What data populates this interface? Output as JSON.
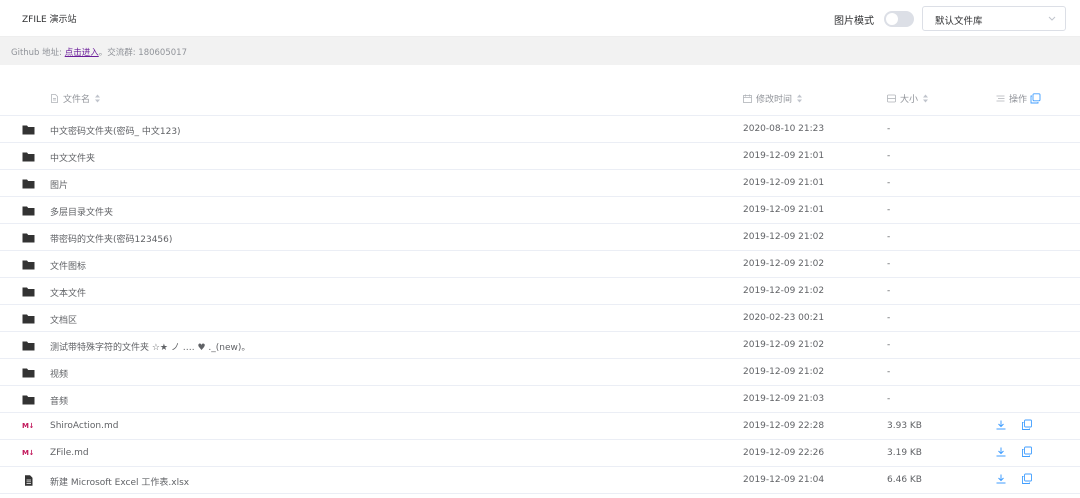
{
  "header": {
    "site_title": "ZFILE 演示站",
    "image_mode_label": "图片模式",
    "image_mode_on": false,
    "drive_select": "默认文件库"
  },
  "infobar": {
    "prefix": "Github 地址: ",
    "link_text": "点击进入",
    "suffix": "。交流群: 180605017"
  },
  "table": {
    "columns": {
      "name": "文件名",
      "time": "修改时间",
      "size": "大小",
      "ops": "操作"
    },
    "rows": [
      {
        "type": "folder",
        "name": "中文密码文件夹(密码_ 中文123)",
        "time": "2020-08-10 21:23",
        "size": "-"
      },
      {
        "type": "folder",
        "name": "中文文件夹",
        "time": "2019-12-09 21:01",
        "size": "-"
      },
      {
        "type": "folder",
        "name": "图片",
        "time": "2019-12-09 21:01",
        "size": "-"
      },
      {
        "type": "folder",
        "name": "多层目录文件夹",
        "time": "2019-12-09 21:01",
        "size": "-"
      },
      {
        "type": "folder",
        "name": "带密码的文件夹(密码123456)",
        "time": "2019-12-09 21:02",
        "size": "-"
      },
      {
        "type": "folder",
        "name": "文件图标",
        "time": "2019-12-09 21:02",
        "size": "-"
      },
      {
        "type": "folder",
        "name": "文本文件",
        "time": "2019-12-09 21:02",
        "size": "-"
      },
      {
        "type": "folder",
        "name": "文档区",
        "time": "2020-02-23 00:21",
        "size": "-"
      },
      {
        "type": "folder",
        "name": "测试带特殊字符的文件夹 ☆★ ノ …. ♥ ._(new)。",
        "time": "2019-12-09 21:02",
        "size": "-"
      },
      {
        "type": "folder",
        "name": "视频",
        "time": "2019-12-09 21:02",
        "size": "-"
      },
      {
        "type": "folder",
        "name": "音频",
        "time": "2019-12-09 21:03",
        "size": "-"
      },
      {
        "type": "markdown",
        "name": "ShiroAction.md",
        "time": "2019-12-09 22:28",
        "size": "3.93 KB"
      },
      {
        "type": "markdown",
        "name": "ZFile.md",
        "time": "2019-12-09 22:26",
        "size": "3.19 KB"
      },
      {
        "type": "document",
        "name": "新建 Microsoft Excel 工作表.xlsx",
        "time": "2019-12-09 21:04",
        "size": "6.46 KB"
      }
    ]
  },
  "icons": {
    "folder": "folder-icon",
    "markdown": "markdown-icon",
    "document": "document-icon",
    "download": "download-icon",
    "copy": "copy-link-icon"
  },
  "colors": {
    "accent": "#409eff",
    "link": "#6a1b9a",
    "markdown": "#c2185b",
    "folder": "#333333"
  }
}
